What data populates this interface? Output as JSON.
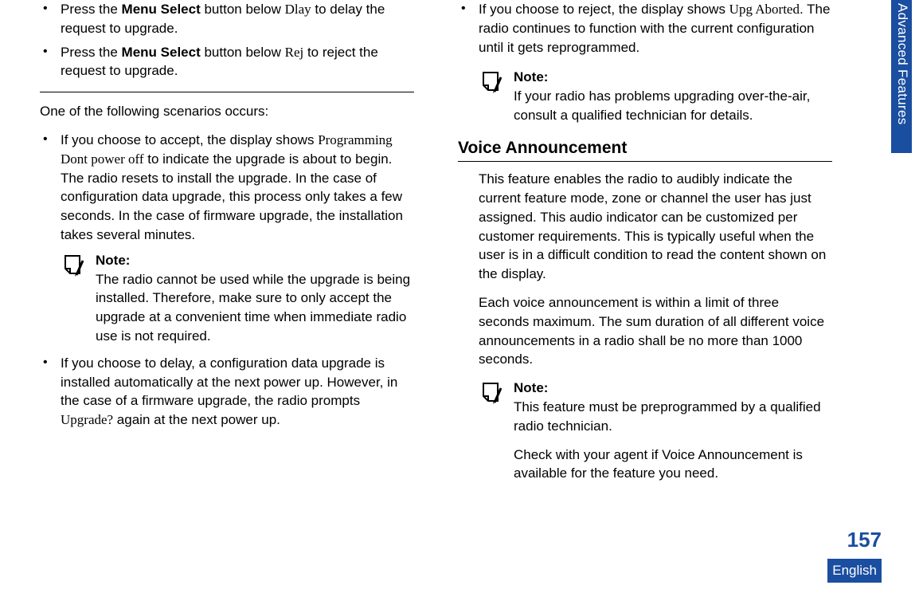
{
  "sideTab": "Advanced Features",
  "pageNumber": "157",
  "language": "English",
  "left": {
    "bullet1_a": "Press the ",
    "bullet1_b": "Menu Select",
    "bullet1_c": " button below ",
    "bullet1_d": "Dlay",
    "bullet1_e": " to delay the request to upgrade.",
    "bullet2_a": "Press the ",
    "bullet2_b": "Menu Select",
    "bullet2_c": " button below ",
    "bullet2_d": "Rej",
    "bullet2_e": " to reject the request to upgrade.",
    "p1": "One of the following scenarios occurs:",
    "bullet3_a": "If you choose to accept, the display shows ",
    "bullet3_b": "Programming Dont power off",
    "bullet3_c": " to indicate the upgrade is about to begin. The radio resets to install the upgrade. In the case of configuration data upgrade, this process only takes a few seconds. In the case of firmware upgrade, the installation takes several minutes.",
    "note1_label": "Note:",
    "note1_text": "The radio cannot be used while the upgrade is being installed. Therefore, make sure to only accept the upgrade at a convenient time when immediate radio use is not required.",
    "bullet4_a": "If you choose to delay, a configuration data upgrade is installed automatically at the next power up. However, in the case of a firmware upgrade, the radio prompts ",
    "bullet4_b": "Upgrade?",
    "bullet4_c": " again at the next power up."
  },
  "right": {
    "bullet1_a": "If you choose to reject, the display shows ",
    "bullet1_b": "Upg Aborted",
    "bullet1_c": ". The radio continues to function with the current configuration until it gets reprogrammed.",
    "note1_label": "Note:",
    "note1_text": "If your radio has problems upgrading over-the-air, consult a qualified technician for details.",
    "sectionTitle": "Voice Announcement",
    "p1": "This feature enables the radio to audibly indicate the current feature mode, zone or channel the user has just assigned. This audio indicator can be customized per customer requirements. This is typically useful when the user is in a difficult condition to read the content shown on the display.",
    "p2": "Each voice announcement is within a limit of three seconds maximum. The sum duration of all different voice announcements in a radio shall be no more than 1000 seconds.",
    "note2_label": "Note:",
    "note2_text1": "This feature must be preprogrammed by a qualified radio technician.",
    "note2_text2": "Check with your agent if Voice Announcement is available for the feature you need."
  }
}
